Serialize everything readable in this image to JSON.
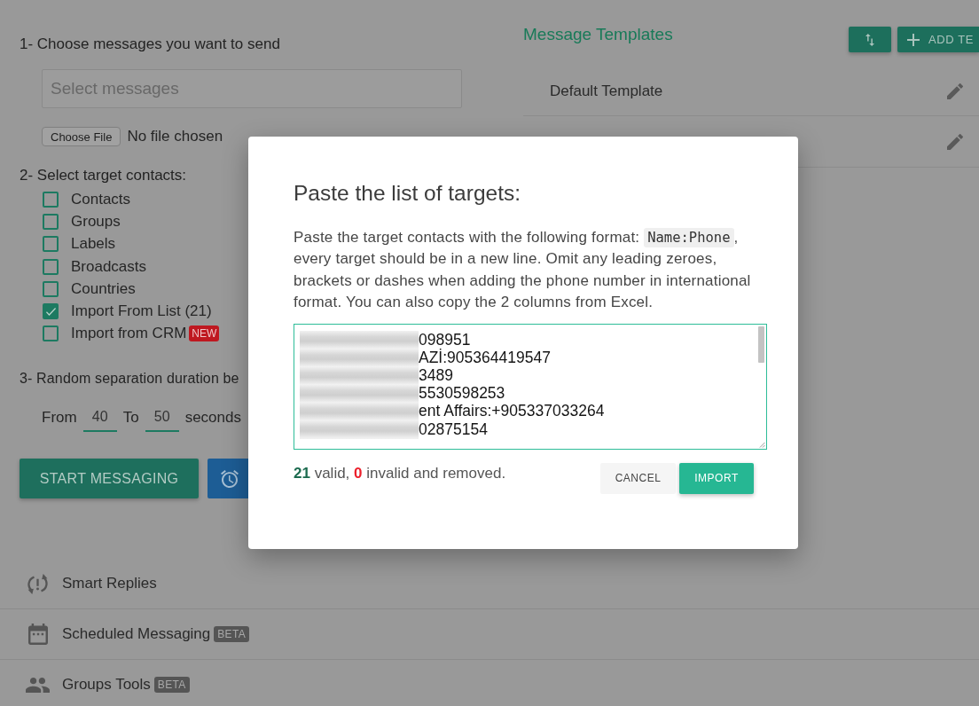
{
  "messages_section": {
    "heading": "1- Choose messages you want to send",
    "select": {
      "placeholder": "Select messages"
    },
    "file_input": {
      "button": "Choose File",
      "status": "No file chosen"
    }
  },
  "targets_section": {
    "heading": "2- Select target contacts:",
    "options": [
      {
        "label": "Contacts",
        "checked": false
      },
      {
        "label": "Groups",
        "checked": false
      },
      {
        "label": "Labels",
        "checked": false
      },
      {
        "label": "Broadcasts",
        "checked": false
      },
      {
        "label": "Countries",
        "checked": false
      },
      {
        "label": "Import From List (21)",
        "checked": true
      },
      {
        "label": "Import from CRM",
        "checked": false,
        "badge": "NEW"
      }
    ]
  },
  "interval_section": {
    "heading": "3- Random separation duration be",
    "from_label": "From",
    "from_value": "40",
    "to_label": "To",
    "to_value": "50",
    "unit": "seconds"
  },
  "start_button": "START MESSAGING",
  "templates": {
    "title": "Message Templates",
    "add_button": "ADD TE",
    "items": [
      {
        "title": "Default Template",
        "editable": true
      },
      {
        "editable": true
      }
    ]
  },
  "features": [
    {
      "label": "Smart Replies"
    },
    {
      "label": "Scheduled Messaging",
      "badge": "BETA"
    },
    {
      "label": "Groups Tools",
      "badge": "BETA"
    }
  ],
  "dialog": {
    "title": "Paste the list of targets:",
    "instructions": {
      "before": "Paste the target contacts with the following format:",
      "code": "Name:Phone",
      "after": ", every target should be in a new line. Omit any leading zeroes, brackets or dashes when adding the phone number in international format. You can also copy the 2 columns from Excel."
    },
    "textarea": {
      "names_blurred": true,
      "lines": [
        "098951",
        "AZİ:905364419547",
        "3489",
        "5530598253",
        "ent Affairs:+905337033264",
        "02875154"
      ]
    },
    "summary": {
      "valid_count": "21",
      "valid_text": "valid,",
      "invalid_count": "0",
      "invalid_text": "invalid and removed."
    },
    "buttons": [
      {
        "label": "CANCEL",
        "kind": "secondary"
      },
      {
        "label": "IMPORT",
        "kind": "primary"
      }
    ]
  }
}
